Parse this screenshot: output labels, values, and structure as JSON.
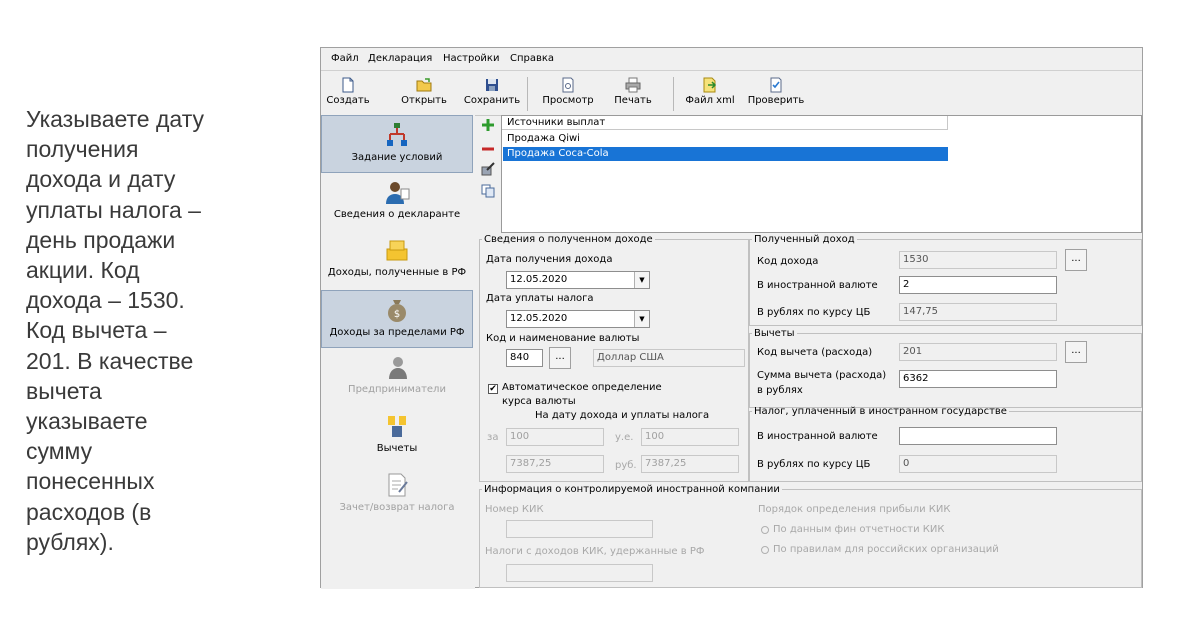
{
  "caption": {
    "lines": [
      "Указываете дату",
      "получения",
      "дохода и дату",
      "уплаты налога –",
      "день продажи",
      "акции. Код",
      "дохода – 1530.",
      "Код вычета –",
      "201. В качестве",
      "вычета",
      "указываете",
      "сумму",
      "понесенных",
      "расходов (в",
      "рублях)."
    ]
  },
  "menu": [
    "Файл",
    "Декларация",
    "Настройки",
    "Справка"
  ],
  "toolbar": {
    "create": "Создать",
    "open": "Открыть",
    "save": "Сохранить",
    "preview": "Просмотр",
    "print": "Печать",
    "xml": "Файл xml",
    "check": "Проверить"
  },
  "sidebar": {
    "items": [
      {
        "label": "Задание условий",
        "icon": "conditions-icon"
      },
      {
        "label": "Сведения о декларанте",
        "icon": "person-icon"
      },
      {
        "label": "Доходы, полученные в РФ",
        "icon": "coins-icon"
      },
      {
        "label": "Доходы за пределами РФ",
        "icon": "money-bag-icon"
      },
      {
        "label": "Предприниматели",
        "icon": "businessman-icon"
      },
      {
        "label": "Вычеты",
        "icon": "deductions-icon"
      },
      {
        "label": "Зачет/возврат налога",
        "icon": "document-icon"
      }
    ]
  },
  "sources": {
    "header": "Источники выплат",
    "rows": [
      "Продажа Qiwi",
      "Продажа Coca-Cola"
    ]
  },
  "income_info": {
    "legend": "Сведения о полученном доходе",
    "income_date_label": "Дата получения дохода",
    "income_date": "12.05.2020",
    "tax_date_label": "Дата уплаты налога",
    "tax_date": "12.05.2020",
    "currency_label": "Код и наименование валюты",
    "currency_code": "840",
    "currency_name": "Доллар США",
    "auto_rate_label_1": "Автоматическое определение",
    "auto_rate_label_2": "курса валюты",
    "auto_rate_checked": "✔",
    "rate_dates_label": "На дату дохода и уплаты налога",
    "for_label": "за",
    "units_label": "у.е.",
    "rub_label": "руб.",
    "income_units": "100",
    "tax_units": "100",
    "income_rub": "7387,25",
    "tax_rub": "7387,25"
  },
  "received_income": {
    "legend": "Полученный доход",
    "code_label": "Код дохода",
    "code": "1530",
    "foreign_label": "В иностранной валюте",
    "foreign": "2",
    "rub_label": "В рублях по курсу ЦБ",
    "rub": "147,75"
  },
  "deductions": {
    "legend": "Вычеты",
    "code_label": "Код вычета (расхода)",
    "code": "201",
    "sum_label_1": "Сумма вычета (расхода)",
    "sum_label_2": "в рублях",
    "sum": "6362"
  },
  "foreign_tax": {
    "legend": "Налог, уплаченный в иностранном государстве",
    "foreign_label": "В иностранной валюте",
    "foreign": "",
    "rub_label": "В рублях по курсу ЦБ",
    "rub": "0"
  },
  "kik": {
    "legend": "Информация о контролируемой иностранной компании",
    "number_label": "Номер КИК",
    "taxes_label": "Налоги с доходов КИК, удержанные в РФ",
    "profit_label": "Порядок определения прибыли КИК",
    "option1": "По данным фин отчетности КИК",
    "option2": "По правилам для российских организаций"
  },
  "dots": "...",
  "colors": {
    "selection": "#1874d6",
    "sidebar_selected": "#c9d3df"
  }
}
